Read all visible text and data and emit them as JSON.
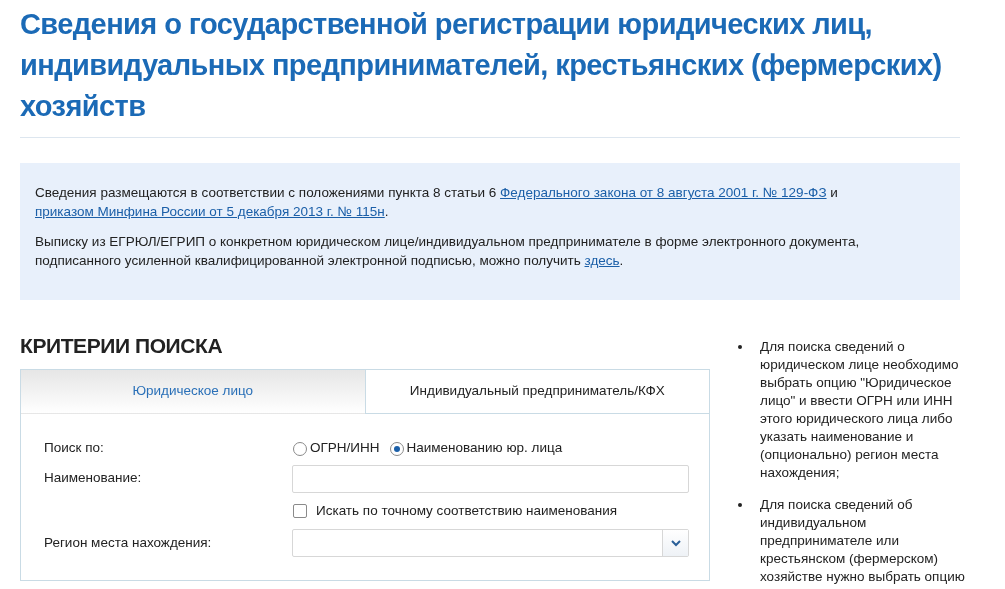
{
  "title": "Сведения о государственной регистрации юридических лиц, индивидуальных предпринимателей, крестьянских (фермерских) хозяйств",
  "notice": {
    "paragraphs": [
      {
        "segments": [
          {
            "text": "Сведения размещаются в соответствии с положениями пункта 8 статьи 6 ",
            "kind": "text"
          },
          {
            "text": "Федерального закона от 8 августа 2001 г. № 129-ФЗ",
            "kind": "link"
          },
          {
            "text": " и ",
            "kind": "text"
          },
          {
            "text": "приказом Минфина России от 5 декабря 2013 г. № 115н",
            "kind": "link"
          },
          {
            "text": ".",
            "kind": "text"
          }
        ]
      },
      {
        "segments": [
          {
            "text": "Выписку из ЕГРЮЛ/ЕГРИП о конкретном юридическом лице/индивидуальном предпринимателе в форме электронного документа, подписанного усиленной квалифицированной электронной подписью, можно получить ",
            "kind": "text"
          },
          {
            "text": "здесь",
            "kind": "link"
          },
          {
            "text": ".",
            "kind": "text"
          }
        ]
      }
    ]
  },
  "search": {
    "heading": "КРИТЕРИИ ПОИСКА",
    "tabs": [
      {
        "label": "Юридическое лицо",
        "selected": true
      },
      {
        "label": "Индивидуальный предприниматель/КФХ",
        "selected": false
      }
    ],
    "fields": [
      {
        "kind": "radio",
        "label": "Поиск по:",
        "options": [
          {
            "label": "ОГРН/ИНН",
            "selected": false
          },
          {
            "label": "Наименованию юр. лица",
            "selected": true
          }
        ]
      },
      {
        "kind": "text",
        "label": "Наименование:"
      },
      {
        "kind": "checkbox",
        "text": "Искать по точному соответствию наименования",
        "checked": false
      },
      {
        "kind": "select",
        "label": "Регион места нахождения:"
      }
    ]
  },
  "help": {
    "items": [
      "Для поиска сведений о юридическом лице необходимо выбрать опцию \"Юридическое лицо\" и ввести ОГРН или ИНН этого юридического лица либо указать наименование и (опционально) регион места нахождения;",
      "Для поиска сведений об индивидуальном предпринимателе или крестьянском (фермерском) хозяйстве нужно выбрать опцию"
    ]
  }
}
